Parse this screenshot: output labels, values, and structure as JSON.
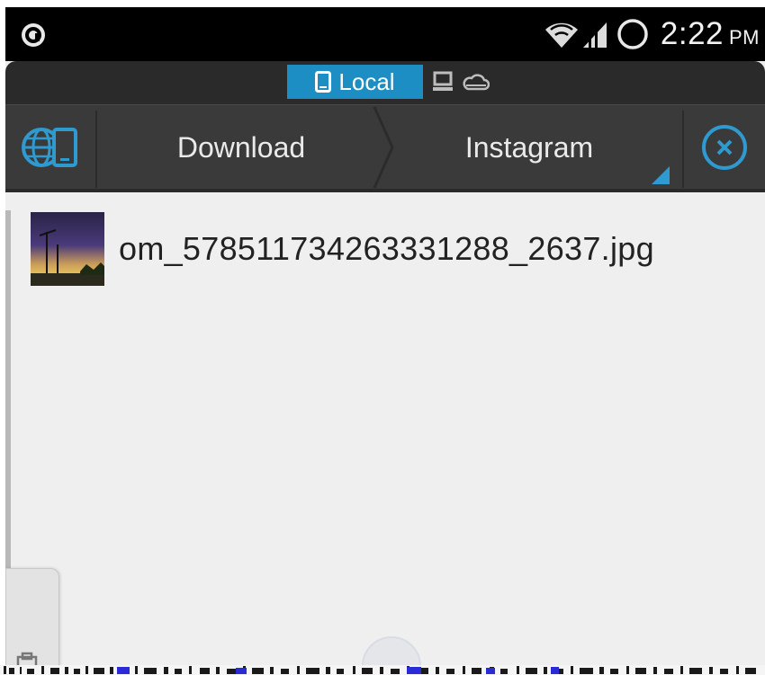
{
  "status_bar": {
    "time": "2:22",
    "ampm": "PM",
    "icons": [
      "notification-icon",
      "wifi-icon",
      "signal-icon",
      "battery-icon"
    ]
  },
  "location_tabs": {
    "active": "Local",
    "items": [
      {
        "icon": "phone-icon",
        "label": "Local"
      },
      {
        "icon": "computer-icon",
        "label": ""
      },
      {
        "icon": "cloud-icon",
        "label": ""
      }
    ]
  },
  "toolbar": {
    "left_icon": "network-device-icon",
    "breadcrumbs": [
      "Download",
      "Instagram"
    ],
    "close_icon": "close-icon"
  },
  "files": [
    {
      "name": "om_578511734263331288_2637.jpg",
      "thumb_icon": "image-thumbnail"
    }
  ],
  "colors": {
    "accent": "#1d8ec4",
    "toolbar_bg": "#3a3a3a",
    "list_bg": "#efefef",
    "status_bg": "#000000"
  }
}
